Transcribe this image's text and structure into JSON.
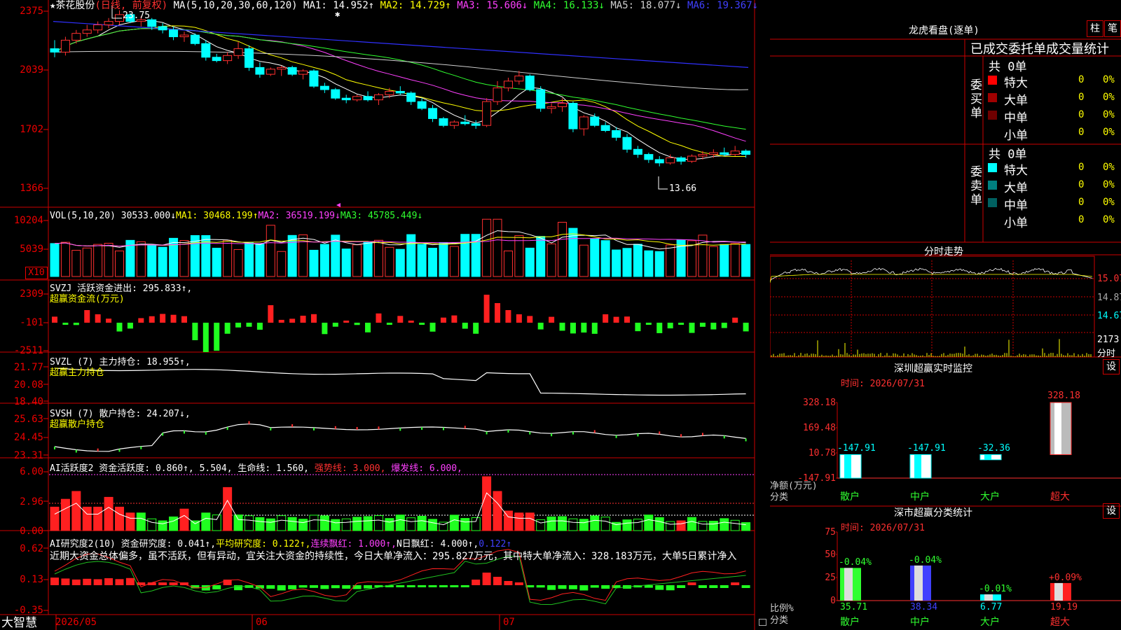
{
  "header": {
    "star": "★",
    "stock": "茶花股份",
    "mode": "(日线, 前复权)",
    "ma_label": "MA(5,10,20,30,60,120)",
    "ma": [
      {
        "name": "MA1:",
        "val": "14.952↑",
        "color": "#ffffff"
      },
      {
        "name": "MA2:",
        "val": "14.729↑",
        "color": "#ffff00"
      },
      {
        "name": "MA3:",
        "val": "15.606↓",
        "color": "#ff40ff"
      },
      {
        "name": "MA4:",
        "val": "16.133↓",
        "color": "#30ff30"
      },
      {
        "name": "MA5:",
        "val": "18.077↓",
        "color": "#d0d0d0"
      },
      {
        "name": "MA6:",
        "val": "19.367↓",
        "color": "#4040ff"
      }
    ],
    "high_label": "23.75",
    "low_label": "13.66"
  },
  "price_axis": [
    "2375",
    "2039",
    "1702",
    "1366"
  ],
  "vol": {
    "label": "VOL(5,10,20)",
    "value": "30533.000↓",
    "ma1": "MA1: 30468.199↑",
    "ma2": "MA2: 36519.199↓",
    "ma3": "MA3: 45785.449↓",
    "axis": [
      "10204",
      "5039"
    ],
    "unit": "X10"
  },
  "svzj": {
    "title": "SVZJ  活跃资金进出: 295.833↑,",
    "sub": "超赢资金流(万元)",
    "axis": [
      "2309",
      "-101",
      "-2511"
    ]
  },
  "svzl": {
    "title": "SVZL (7) 主力持仓: 18.955↑,",
    "sub": "超赢主力持仓",
    "axis": [
      "21.77",
      "20.08",
      "18.40"
    ]
  },
  "svsh": {
    "title": "SVSH (7) 散户持仓: 24.207↓,",
    "sub": "超赢散户持仓",
    "axis": [
      "25.63",
      "24.45",
      "23.31"
    ]
  },
  "ai1": {
    "title": "AI活跃度2 资金活跃度: 0.860↑, 5.504, 生命线: 1.560,",
    "strong": "强势线: 3.000,",
    "burst": "爆发线: 6.000,",
    "axis": [
      "6.00",
      "2.96",
      "0.00"
    ]
  },
  "ai2": {
    "title": "AI研究度2(10) 资金研究度: 0.041↑,",
    "avg": "平均研究度: 0.122↑,",
    "cont": "连续飘红: 1.000↑,",
    "nday": "N日飘红: 4.000↑,",
    "last": "0.122↑",
    "text": "近期大资金总体偏多，虽不活跃，但有异动，宜关注大资金的持续性，今日大单净流入：295.827万元，其中特大单净流入：328.183万元，大单5日累计净入",
    "axis": [
      "0.62",
      "0.13",
      "-0.35"
    ]
  },
  "bottom": {
    "brand": "大智慧",
    "dates": [
      "2026/05",
      "06",
      "07"
    ]
  },
  "right": {
    "lhb_title": "龙虎看盘(逐单)",
    "btn_bar": "柱",
    "btn_pen": "笔",
    "tabs": "已成交委托单成交量统计",
    "buy_label": "委买单",
    "sell_label": "委卖单",
    "buy_total": "共 0单",
    "sell_total": "共 0单",
    "buy_rows": [
      {
        "name": "特大",
        "count": "0",
        "pct": "0%",
        "color": "#ff0000"
      },
      {
        "name": "大单",
        "count": "0",
        "pct": "0%",
        "color": "#a00000"
      },
      {
        "name": "中单",
        "count": "0",
        "pct": "0%",
        "color": "#700000"
      },
      {
        "name": "小单",
        "count": "0",
        "pct": "0%",
        "color": "#000000"
      }
    ],
    "sell_rows": [
      {
        "name": "特大",
        "count": "0",
        "pct": "0%",
        "color": "#00ffff"
      },
      {
        "name": "大单",
        "count": "0",
        "pct": "0%",
        "color": "#008080"
      },
      {
        "name": "中单",
        "count": "0",
        "pct": "0%",
        "color": "#006060"
      },
      {
        "name": "小单",
        "count": "0",
        "pct": "0%",
        "color": "#000000"
      }
    ],
    "fs_title": "分时走势",
    "fs_axis": [
      "15.07",
      "14.87",
      "14.67",
      "2173",
      "分时"
    ],
    "sz_title": "深圳超赢实时监控",
    "sz_btn": "设",
    "sz_time": "时间: 2026/07/31",
    "sz_axis": [
      "328.18",
      "169.48",
      "10.78",
      "-147.91"
    ],
    "sz_y_label": "净额(万元)",
    "sz_x_label": "分类",
    "sz_bars": [
      {
        "cat": "散户",
        "val": -147.91,
        "label": "-147.91"
      },
      {
        "cat": "中户",
        "val": -147.91,
        "label": "-147.91"
      },
      {
        "cat": "大户",
        "val": -32.36,
        "label": "-32.36"
      },
      {
        "cat": "超大",
        "val": 328.18,
        "label": "328.18"
      }
    ],
    "fl_title": "深市超赢分类统计",
    "fl_btn": "设",
    "fl_time": "时间: 2026/07/31",
    "fl_axis": [
      "75",
      "50",
      "25",
      "0"
    ],
    "fl_y_label": "比例%",
    "fl_x_label": "分类",
    "fl_bars": [
      {
        "cat": "散户",
        "val": 35.71,
        "label": "35.71",
        "chg": "-0.04%"
      },
      {
        "cat": "中户",
        "val": 38.34,
        "label": "38.34",
        "chg": "-0.04%"
      },
      {
        "cat": "大户",
        "val": 6.77,
        "label": "6.77",
        "chg": "-0.01%"
      },
      {
        "cat": "超大",
        "val": 19.19,
        "label": "19.19",
        "chg": "+0.09%"
      }
    ]
  },
  "chart_data": {
    "type": "candlestick",
    "ylim": [
      13.0,
      24.0
    ],
    "candles": [
      [
        21.5,
        22.0,
        21.0,
        21.3
      ],
      [
        21.3,
        22.2,
        21.1,
        22.0
      ],
      [
        22.0,
        22.6,
        21.8,
        22.4
      ],
      [
        22.4,
        22.9,
        22.2,
        22.6
      ],
      [
        22.6,
        23.1,
        22.4,
        22.9
      ],
      [
        22.9,
        23.3,
        22.7,
        23.1
      ],
      [
        23.1,
        23.75,
        22.9,
        23.5
      ],
      [
        23.5,
        23.6,
        23.0,
        23.1
      ],
      [
        23.1,
        23.4,
        22.8,
        23.2
      ],
      [
        23.2,
        23.3,
        22.6,
        22.8
      ],
      [
        22.8,
        23.0,
        22.4,
        22.6
      ],
      [
        22.6,
        22.8,
        22.0,
        22.2
      ],
      [
        22.2,
        22.5,
        21.9,
        22.3
      ],
      [
        22.3,
        22.4,
        21.7,
        21.8
      ],
      [
        21.8,
        22.0,
        20.8,
        21.0
      ],
      [
        21.0,
        21.2,
        20.7,
        20.8
      ],
      [
        20.8,
        21.3,
        20.6,
        21.1
      ],
      [
        21.1,
        21.9,
        20.9,
        21.5
      ],
      [
        21.5,
        21.7,
        20.2,
        20.4
      ],
      [
        20.4,
        20.7,
        19.8,
        20.0
      ],
      [
        20.0,
        20.4,
        19.9,
        20.3
      ],
      [
        20.3,
        20.5,
        19.9,
        20.4
      ],
      [
        20.4,
        20.5,
        19.9,
        20.0
      ],
      [
        20.0,
        20.3,
        19.7,
        20.2
      ],
      [
        20.2,
        20.3,
        19.2,
        19.3
      ],
      [
        19.3,
        19.5,
        18.9,
        19.1
      ],
      [
        19.1,
        19.2,
        18.5,
        18.6
      ],
      [
        18.6,
        18.8,
        18.3,
        18.5
      ],
      [
        18.5,
        18.8,
        18.4,
        18.7
      ],
      [
        18.7,
        19.0,
        18.4,
        18.5
      ],
      [
        18.5,
        18.9,
        18.2,
        18.8
      ],
      [
        18.8,
        19.2,
        18.6,
        19.0
      ],
      [
        19.0,
        19.3,
        18.8,
        18.9
      ],
      [
        18.9,
        19.0,
        18.2,
        18.4
      ],
      [
        18.4,
        18.6,
        17.9,
        18.0
      ],
      [
        18.0,
        18.2,
        17.2,
        17.4
      ],
      [
        17.4,
        17.5,
        16.9,
        17.0
      ],
      [
        17.0,
        17.3,
        16.8,
        17.2
      ],
      [
        17.2,
        17.6,
        17.0,
        17.1
      ],
      [
        17.1,
        17.3,
        16.8,
        17.0
      ],
      [
        17.0,
        18.6,
        16.9,
        18.4
      ],
      [
        18.4,
        19.6,
        18.2,
        19.2
      ],
      [
        19.2,
        19.8,
        19.0,
        19.6
      ],
      [
        19.6,
        20.2,
        19.4,
        19.9
      ],
      [
        19.9,
        20.0,
        19.0,
        19.1
      ],
      [
        19.1,
        19.3,
        17.8,
        18.0
      ],
      [
        18.0,
        18.3,
        17.7,
        18.1
      ],
      [
        18.1,
        18.6,
        17.8,
        18.3
      ],
      [
        18.3,
        18.4,
        16.6,
        16.8
      ],
      [
        16.8,
        17.6,
        16.4,
        17.5
      ],
      [
        17.5,
        17.7,
        16.9,
        17.0
      ],
      [
        17.0,
        17.2,
        16.6,
        16.7
      ],
      [
        16.7,
        16.9,
        16.1,
        16.3
      ],
      [
        16.3,
        16.5,
        15.4,
        15.6
      ],
      [
        15.6,
        15.8,
        15.1,
        15.3
      ],
      [
        15.3,
        15.4,
        14.8,
        15.0
      ],
      [
        15.0,
        15.2,
        14.6,
        14.8
      ],
      [
        14.8,
        15.3,
        14.7,
        15.1
      ],
      [
        15.1,
        15.2,
        14.7,
        14.9
      ],
      [
        14.9,
        15.3,
        14.8,
        15.2
      ],
      [
        15.2,
        15.5,
        15.0,
        15.3
      ],
      [
        15.3,
        15.6,
        15.1,
        15.4
      ],
      [
        15.4,
        15.7,
        15.2,
        15.3
      ],
      [
        15.3,
        15.8,
        15.2,
        15.5
      ],
      [
        15.5,
        15.6,
        15.1,
        15.3
      ]
    ]
  }
}
